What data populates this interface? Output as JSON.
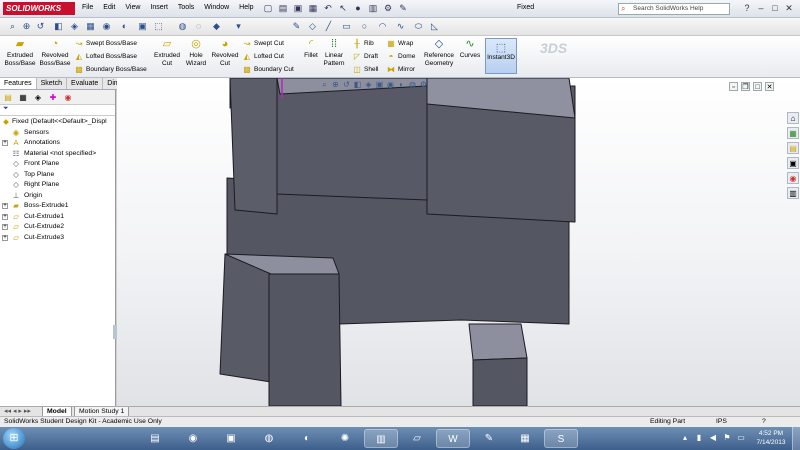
{
  "app": {
    "logo_text": "SOLIDWORKS",
    "document_title": "Fixed",
    "menus": [
      "File",
      "Edit",
      "View",
      "Insert",
      "Tools",
      "Window",
      "Help"
    ],
    "help_search_placeholder": "Search SolidWorks Help",
    "window_controls": [
      "?",
      "–",
      "□",
      "✕"
    ]
  },
  "command_manager": {
    "extruded_boss": "Extruded Boss/Base",
    "revolved_boss": "Revolved Boss/Base",
    "swept_boss": "Swept Boss/Base",
    "lofted_boss": "Lofted Boss/Base",
    "boundary_boss": "Boundary Boss/Base",
    "extruded_cut": "Extruded Cut",
    "hole_wizard": "Hole Wizard",
    "revolved_cut": "Revolved Cut",
    "swept_cut": "Swept Cut",
    "lofted_cut": "Lofted Cut",
    "boundary_cut": "Boundary Cut",
    "fillet": "Fillet",
    "linear_pattern": "Linear Pattern",
    "rib": "Rib",
    "draft": "Draft",
    "shell": "Shell",
    "wrap": "Wrap",
    "dome": "Dome",
    "mirror": "Mirror",
    "reference_geometry": "Reference Geometry",
    "curves": "Curves",
    "instant3d": "Instant3D"
  },
  "tabs": [
    "Features",
    "Sketch",
    "Evaluate",
    "DimXpert"
  ],
  "tree": {
    "root": "Fixed  (Default<<Default>_Displ",
    "items": [
      {
        "label": "Sensors",
        "icon": "sensor-icon",
        "expand": false
      },
      {
        "label": "Annotations",
        "icon": "annotation-icon",
        "expand": true
      },
      {
        "label": "Material <not specified>",
        "icon": "material-icon",
        "expand": false
      },
      {
        "label": "Front Plane",
        "icon": "plane-icon",
        "expand": false
      },
      {
        "label": "Top Plane",
        "icon": "plane-icon",
        "expand": false
      },
      {
        "label": "Right Plane",
        "icon": "plane-icon",
        "expand": false
      },
      {
        "label": "Origin",
        "icon": "origin-icon",
        "expand": false
      },
      {
        "label": "Boss-Extrude1",
        "icon": "boss-extrude-icon",
        "expand": true
      },
      {
        "label": "Cut-Extrude1",
        "icon": "cut-extrude-icon",
        "expand": true
      },
      {
        "label": "Cut-Extrude2",
        "icon": "cut-extrude-icon",
        "expand": true
      },
      {
        "label": "Cut-Extrude3",
        "icon": "cut-extrude-icon",
        "expand": true
      }
    ]
  },
  "bottom_tabs": [
    "Model",
    "Motion Study 1"
  ],
  "status": {
    "left": "SolidWorks Student Design Kit - Academic Use Only",
    "mode": "Editing Part",
    "units": "IPS",
    "help": "?"
  },
  "taskbar": {
    "time": "4:52 PM",
    "date": "7/14/2013"
  },
  "colors": {
    "model_face": "#545661",
    "model_top": "#8d8f9e",
    "model_edge": "#1b1b22",
    "accent_red": "#c8102e"
  }
}
